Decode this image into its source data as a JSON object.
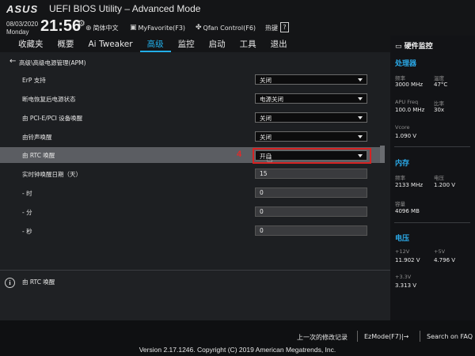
{
  "header": {
    "logo": "ASUS",
    "title": "UEFI BIOS Utility – Advanced Mode",
    "date": "08/03/2020",
    "weekday": "Monday",
    "time": "21:56",
    "tools": [
      {
        "icon": "globe-icon",
        "label": "简体中文"
      },
      {
        "icon": "favorite-icon",
        "label": "MyFavorite(F3)"
      },
      {
        "icon": "fan-icon",
        "label": "Qfan Control(F6)"
      }
    ],
    "hotkey_label": "热键",
    "hotkey_key": "?"
  },
  "tabs": [
    {
      "label": "收藏夹",
      "active": false
    },
    {
      "label": "概要",
      "active": false
    },
    {
      "label": "Ai Tweaker",
      "active": false
    },
    {
      "label": "高级",
      "active": true
    },
    {
      "label": "监控",
      "active": false
    },
    {
      "label": "启动",
      "active": false
    },
    {
      "label": "工具",
      "active": false
    },
    {
      "label": "退出",
      "active": false
    }
  ],
  "breadcrumb": "高级\\高级电源管理(APM)",
  "settings": [
    {
      "label": "ErP 支持",
      "type": "select",
      "value": "关闭"
    },
    {
      "label": "断电恢复后电源状态",
      "type": "select",
      "value": "电源关闭"
    },
    {
      "label": "由 PCI-E/PCI 设备唤醒",
      "type": "select",
      "value": "关闭"
    },
    {
      "label": "由铃声唤醒",
      "type": "select",
      "value": "关闭"
    },
    {
      "label": "由 RTC 唤醒",
      "type": "select",
      "value": "开启"
    },
    {
      "label": "实时钟唤醒日期（天）",
      "type": "input",
      "value": "15"
    },
    {
      "label": " - 时",
      "type": "input",
      "value": "0"
    },
    {
      "label": " - 分",
      "type": "input",
      "value": "0"
    },
    {
      "label": " - 秒",
      "type": "input",
      "value": "0"
    }
  ],
  "annotation": {
    "step": "4"
  },
  "help_text": "由 RTC 唤醒",
  "hw_monitor": {
    "title": "硬件监控",
    "cpu": {
      "title": "处理器",
      "freq_label": "频率",
      "freq": "3000 MHz",
      "temp_label": "温度",
      "temp": "47°C",
      "apu_label": "APU Freq",
      "apu": "100.0 MHz",
      "ratio_label": "比率",
      "ratio": "30x",
      "vcore_label": "Vcore",
      "vcore": "1.090 V"
    },
    "memory": {
      "title": "内存",
      "freq_label": "频率",
      "freq": "2133 MHz",
      "volt_label": "电压",
      "volt": "1.200 V",
      "cap_label": "容量",
      "cap": "4096 MB"
    },
    "voltage": {
      "title": "电压",
      "v12_label": "+12V",
      "v12": "11.902 V",
      "v5_label": "+5V",
      "v5": "4.796 V",
      "v33_label": "+3.3V",
      "v33": "3.313 V"
    }
  },
  "footer": {
    "last_modified": "上一次的修改记录",
    "ezmode": "EzMode(F7)|→",
    "search": "Search on FAQ",
    "version": "Version 2.17.1246. Copyright (C) 2019 American Megatrends, Inc."
  },
  "colors": {
    "accent": "#22aee8",
    "highlight_box": "#d42323",
    "selected_row": "#5b5d62"
  }
}
